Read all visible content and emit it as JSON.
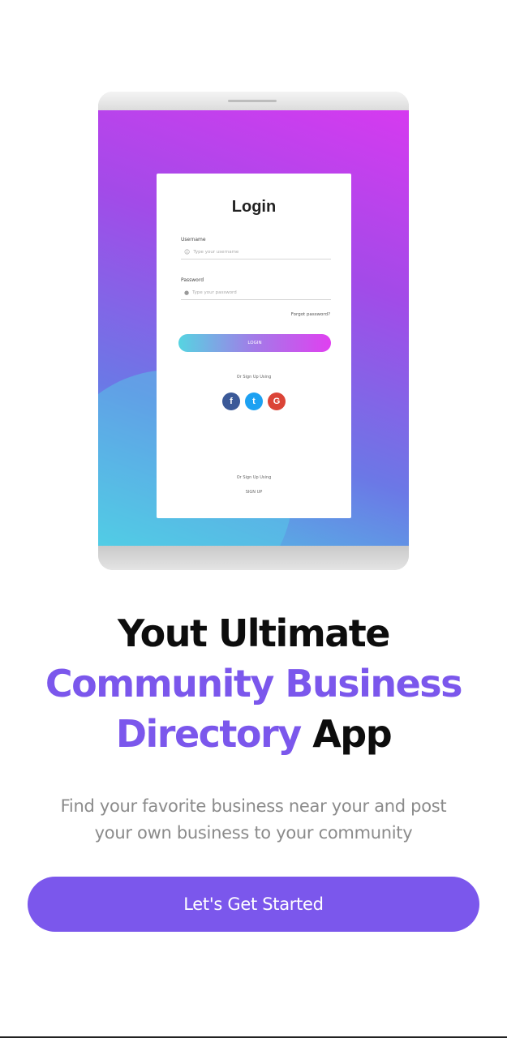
{
  "hero": {
    "login_card": {
      "title": "Login",
      "username_label": "Username",
      "username_placeholder": "Type your username",
      "password_label": "Password",
      "password_placeholder": "Type your password",
      "forgot": "Forgot password?",
      "login_button": "LOGIN",
      "social_text": "Or Sign Up Using",
      "socials": [
        {
          "icon": "facebook-icon",
          "glyph": "f",
          "color": "#3b5998"
        },
        {
          "icon": "twitter-icon",
          "glyph": "t",
          "color": "#1da1f2"
        },
        {
          "icon": "google-icon",
          "glyph": "G",
          "color": "#db4437"
        }
      ],
      "signup_text": "Or Sign Up Using",
      "signup_link": "SIGN UP"
    }
  },
  "heading": {
    "line1": "Yout Ultimate",
    "line2": "Community Business",
    "line3_purple": "Directory",
    "line3_black": " App"
  },
  "subtext": {
    "line1": "Find your favorite business near your and post",
    "line2": "your own business to your community"
  },
  "cta": {
    "label": "Let's Get Started"
  },
  "colors": {
    "accent": "#7b57ec",
    "text_dark": "#0d0d0d",
    "text_muted": "#8b8b8b"
  }
}
